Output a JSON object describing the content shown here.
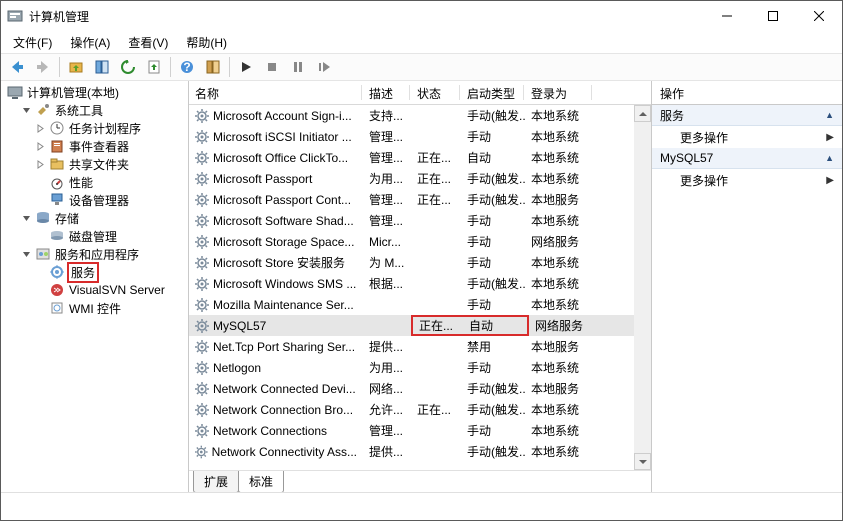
{
  "window": {
    "title": "计算机管理"
  },
  "menu": [
    "文件(F)",
    "操作(A)",
    "查看(V)",
    "帮助(H)"
  ],
  "tree": {
    "root": "计算机管理(本地)",
    "sys_tools": "系统工具",
    "sys_children": [
      "任务计划程序",
      "事件查看器",
      "共享文件夹",
      "性能",
      "设备管理器"
    ],
    "storage": "存储",
    "storage_children": [
      "磁盘管理"
    ],
    "svc_apps": "服务和应用程序",
    "svc_children": [
      "服务",
      "VisualSVN Server",
      "WMI 控件"
    ]
  },
  "columns": {
    "name": "名称",
    "desc": "描述",
    "status": "状态",
    "start": "启动类型",
    "logon": "登录为"
  },
  "rows": [
    {
      "name": "Microsoft Account Sign-i...",
      "desc": "支持...",
      "status": "",
      "start": "手动(触发...",
      "logon": "本地系统"
    },
    {
      "name": "Microsoft iSCSI Initiator ...",
      "desc": "管理...",
      "status": "",
      "start": "手动",
      "logon": "本地系统"
    },
    {
      "name": "Microsoft Office ClickTo...",
      "desc": "管理...",
      "status": "正在...",
      "start": "自动",
      "logon": "本地系统"
    },
    {
      "name": "Microsoft Passport",
      "desc": "为用...",
      "status": "正在...",
      "start": "手动(触发...",
      "logon": "本地系统"
    },
    {
      "name": "Microsoft Passport Cont...",
      "desc": "管理...",
      "status": "正在...",
      "start": "手动(触发...",
      "logon": "本地服务"
    },
    {
      "name": "Microsoft Software Shad...",
      "desc": "管理...",
      "status": "",
      "start": "手动",
      "logon": "本地系统"
    },
    {
      "name": "Microsoft Storage Space...",
      "desc": "Micr...",
      "status": "",
      "start": "手动",
      "logon": "网络服务"
    },
    {
      "name": "Microsoft Store 安装服务",
      "desc": "为 M...",
      "status": "",
      "start": "手动",
      "logon": "本地系统"
    },
    {
      "name": "Microsoft Windows SMS ...",
      "desc": "根据...",
      "status": "",
      "start": "手动(触发...",
      "logon": "本地系统"
    },
    {
      "name": "Mozilla Maintenance Ser...",
      "desc": "",
      "status": "",
      "start": "手动",
      "logon": "本地系统"
    },
    {
      "name": "MySQL57",
      "desc": "",
      "status": "正在...",
      "start": "自动",
      "logon": "网络服务",
      "sel": true,
      "hl": true
    },
    {
      "name": "Net.Tcp Port Sharing Ser...",
      "desc": "提供...",
      "status": "",
      "start": "禁用",
      "logon": "本地服务"
    },
    {
      "name": "Netlogon",
      "desc": "为用...",
      "status": "",
      "start": "手动",
      "logon": "本地系统"
    },
    {
      "name": "Network Connected Devi...",
      "desc": "网络...",
      "status": "",
      "start": "手动(触发...",
      "logon": "本地服务"
    },
    {
      "name": "Network Connection Bro...",
      "desc": "允许...",
      "status": "正在...",
      "start": "手动(触发...",
      "logon": "本地系统"
    },
    {
      "name": "Network Connections",
      "desc": "管理...",
      "status": "",
      "start": "手动",
      "logon": "本地系统"
    },
    {
      "name": "Network Connectivity Ass...",
      "desc": "提供...",
      "status": "",
      "start": "手动(触发...",
      "logon": "本地系统"
    }
  ],
  "tabs": [
    "扩展",
    "标准"
  ],
  "actions": {
    "header": "操作",
    "group1": "服务",
    "row1": "更多操作",
    "group2": "MySQL57",
    "row2": "更多操作"
  }
}
